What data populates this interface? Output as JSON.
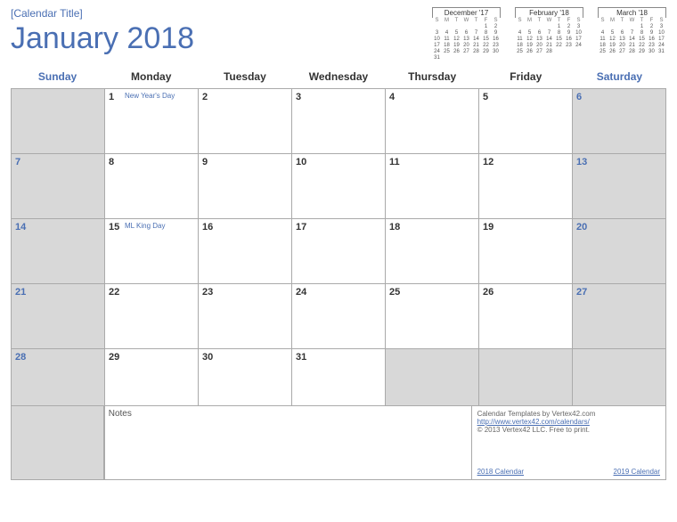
{
  "subtitle": "[Calendar Title]",
  "main_title": "January  2018",
  "day_names": [
    "Sunday",
    "Monday",
    "Tuesday",
    "Wednesday",
    "Thursday",
    "Friday",
    "Saturday"
  ],
  "minis": [
    {
      "title": "December '17",
      "dow": [
        "S",
        "M",
        "T",
        "W",
        "T",
        "F",
        "S"
      ],
      "weeks": [
        [
          "",
          "",
          "",
          "",
          "",
          "1",
          "2"
        ],
        [
          "3",
          "4",
          "5",
          "6",
          "7",
          "8",
          "9"
        ],
        [
          "10",
          "11",
          "12",
          "13",
          "14",
          "15",
          "16"
        ],
        [
          "17",
          "18",
          "19",
          "20",
          "21",
          "22",
          "23"
        ],
        [
          "24",
          "25",
          "26",
          "27",
          "28",
          "29",
          "30"
        ],
        [
          "31",
          "",
          "",
          "",
          "",
          "",
          ""
        ]
      ]
    },
    {
      "title": "February '18",
      "dow": [
        "S",
        "M",
        "T",
        "W",
        "T",
        "F",
        "S"
      ],
      "weeks": [
        [
          "",
          "",
          "",
          "",
          "1",
          "2",
          "3"
        ],
        [
          "4",
          "5",
          "6",
          "7",
          "8",
          "9",
          "10"
        ],
        [
          "11",
          "12",
          "13",
          "14",
          "15",
          "16",
          "17"
        ],
        [
          "18",
          "19",
          "20",
          "21",
          "22",
          "23",
          "24"
        ],
        [
          "25",
          "26",
          "27",
          "28",
          "",
          "",
          ""
        ]
      ]
    },
    {
      "title": "March '18",
      "dow": [
        "S",
        "M",
        "T",
        "W",
        "T",
        "F",
        "S"
      ],
      "weeks": [
        [
          "",
          "",
          "",
          "",
          "1",
          "2",
          "3"
        ],
        [
          "4",
          "5",
          "6",
          "7",
          "8",
          "9",
          "10"
        ],
        [
          "11",
          "12",
          "13",
          "14",
          "15",
          "16",
          "17"
        ],
        [
          "18",
          "19",
          "20",
          "21",
          "22",
          "23",
          "24"
        ],
        [
          "25",
          "26",
          "27",
          "28",
          "29",
          "30",
          "31"
        ]
      ]
    }
  ],
  "weeks": [
    [
      {
        "num": "",
        "shaded": true,
        "weekend": true,
        "event": ""
      },
      {
        "num": "1",
        "shaded": false,
        "weekend": false,
        "event": "New Year's Day"
      },
      {
        "num": "2",
        "shaded": false,
        "weekend": false,
        "event": ""
      },
      {
        "num": "3",
        "shaded": false,
        "weekend": false,
        "event": ""
      },
      {
        "num": "4",
        "shaded": false,
        "weekend": false,
        "event": ""
      },
      {
        "num": "5",
        "shaded": false,
        "weekend": false,
        "event": ""
      },
      {
        "num": "6",
        "shaded": true,
        "weekend": true,
        "event": ""
      }
    ],
    [
      {
        "num": "7",
        "shaded": true,
        "weekend": true,
        "event": ""
      },
      {
        "num": "8",
        "shaded": false,
        "weekend": false,
        "event": ""
      },
      {
        "num": "9",
        "shaded": false,
        "weekend": false,
        "event": ""
      },
      {
        "num": "10",
        "shaded": false,
        "weekend": false,
        "event": ""
      },
      {
        "num": "11",
        "shaded": false,
        "weekend": false,
        "event": ""
      },
      {
        "num": "12",
        "shaded": false,
        "weekend": false,
        "event": ""
      },
      {
        "num": "13",
        "shaded": true,
        "weekend": true,
        "event": ""
      }
    ],
    [
      {
        "num": "14",
        "shaded": true,
        "weekend": true,
        "event": ""
      },
      {
        "num": "15",
        "shaded": false,
        "weekend": false,
        "event": "ML King Day"
      },
      {
        "num": "16",
        "shaded": false,
        "weekend": false,
        "event": ""
      },
      {
        "num": "17",
        "shaded": false,
        "weekend": false,
        "event": ""
      },
      {
        "num": "18",
        "shaded": false,
        "weekend": false,
        "event": ""
      },
      {
        "num": "19",
        "shaded": false,
        "weekend": false,
        "event": ""
      },
      {
        "num": "20",
        "shaded": true,
        "weekend": true,
        "event": ""
      }
    ],
    [
      {
        "num": "21",
        "shaded": true,
        "weekend": true,
        "event": ""
      },
      {
        "num": "22",
        "shaded": false,
        "weekend": false,
        "event": ""
      },
      {
        "num": "23",
        "shaded": false,
        "weekend": false,
        "event": ""
      },
      {
        "num": "24",
        "shaded": false,
        "weekend": false,
        "event": ""
      },
      {
        "num": "25",
        "shaded": false,
        "weekend": false,
        "event": ""
      },
      {
        "num": "26",
        "shaded": false,
        "weekend": false,
        "event": ""
      },
      {
        "num": "27",
        "shaded": true,
        "weekend": true,
        "event": ""
      }
    ],
    [
      {
        "num": "28",
        "shaded": true,
        "weekend": true,
        "event": ""
      },
      {
        "num": "29",
        "shaded": false,
        "weekend": false,
        "event": ""
      },
      {
        "num": "30",
        "shaded": false,
        "weekend": false,
        "event": ""
      },
      {
        "num": "31",
        "shaded": false,
        "weekend": false,
        "event": ""
      },
      {
        "num": "",
        "shaded": true,
        "weekend": false,
        "event": ""
      },
      {
        "num": "",
        "shaded": true,
        "weekend": false,
        "event": ""
      },
      {
        "num": "",
        "shaded": true,
        "weekend": true,
        "event": ""
      }
    ]
  ],
  "notes_label": "Notes",
  "credits": {
    "line1": "Calendar Templates by Vertex42.com",
    "line2": "http://www.vertex42.com/calendars/",
    "line3": "© 2013 Vertex42 LLC. Free to print.",
    "link1": "2018 Calendar",
    "link2": "2019 Calendar"
  }
}
